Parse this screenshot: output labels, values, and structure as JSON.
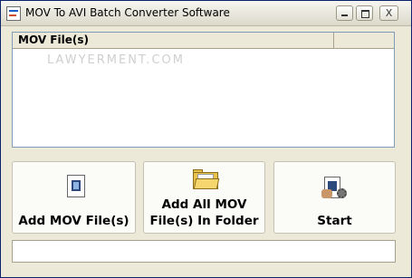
{
  "window": {
    "title": "MOV To AVI Batch Converter Software",
    "controls": {
      "minimize": "minimize",
      "maximize": "maximize",
      "close": "X"
    }
  },
  "file_list": {
    "columns": [
      "MOV File(s)",
      ""
    ],
    "watermark": "LAWYERMENT.COM",
    "rows": []
  },
  "buttons": {
    "add_files": {
      "label": "Add MOV File(s)",
      "icon": "document-video-icon"
    },
    "add_folder": {
      "label_line1": "Add All MOV",
      "label_line2": "File(s) In Folder",
      "icon": "folder-icon"
    },
    "start": {
      "label": "Start",
      "icon": "start-convert-icon"
    }
  },
  "status_bar": {
    "text": ""
  },
  "colors": {
    "face": "#ece9d8",
    "border": "#7f9db9",
    "folder": "#e9c24c"
  }
}
